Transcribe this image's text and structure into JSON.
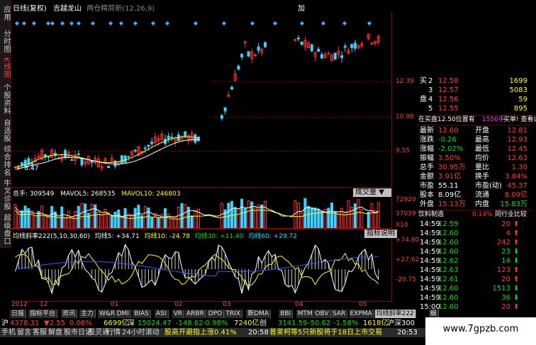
{
  "header": {
    "line1": "日线(复权)",
    "stock": "吉越龙山",
    "indicator": "两仓精简新(12,26,9)",
    "corner": "加"
  },
  "left_tabs": [
    "应用",
    "分时图",
    "K线图",
    "个股资料",
    "自选股",
    "综合排名",
    "牛叉诊股",
    "超级盘口"
  ],
  "kline": {
    "axis": [
      "12.39",
      "10.98",
      "9.55"
    ],
    "low_label": "8.47"
  },
  "volume": {
    "title": "总手: 309549",
    "mavol5": "MAVOL5: 268535",
    "mavol10": "MAVOL10: 246803",
    "button": "成交量",
    "axis": [
      "72920",
      "37039",
      "X10"
    ]
  },
  "indicator": {
    "title": "均线斜率222(5,10,30,60)",
    "l5": "均线5: +34.71",
    "l10": "均线10: -24.78",
    "l30": "均线30: +11.40",
    "l60": "均线60: +29.72",
    "button": "指标说明",
    "axis": [
      "+74.80",
      "+27.62",
      "-20.75"
    ]
  },
  "dates": [
    "2012",
    "12",
    "01",
    "02",
    "03",
    "04",
    "05"
  ],
  "orderbook": [
    {
      "side": "买",
      "n": "2",
      "price": "12.58",
      "vol": "1699"
    },
    {
      "side": "",
      "n": "3",
      "price": "12.57",
      "vol": "5083"
    },
    {
      "side": "盘",
      "n": "4",
      "price": "12.56",
      "vol": "59"
    },
    {
      "side": "",
      "n": "5",
      "price": "12.55",
      "vol": "895"
    }
  ],
  "info_line": {
    "left": "在买盘12.50位置有",
    "mid": "1550手",
    "right": "买单! 查看详细"
  },
  "quote": [
    {
      "l": "最新",
      "lv": "12.60",
      "r": "开盘",
      "rv": "12.81"
    },
    {
      "l": "涨跌",
      "lv": "-0.26",
      "r": "最高",
      "rv": "12.93"
    },
    {
      "l": "涨幅",
      "lv": "-2.02%",
      "r": "最低",
      "rv": "12.45"
    },
    {
      "l": "振幅",
      "lv": "3.50%",
      "r": "均价",
      "rv": "12.63"
    },
    {
      "l": "总手",
      "lv": "30.95万",
      "r": "量比",
      "rv": "1.30"
    },
    {
      "l": "金额",
      "lv": "3.91亿",
      "r": "换手",
      "rv": "3.84%"
    },
    {
      "l": "市盈",
      "lv": "55.11",
      "r": "市盈(动)",
      "rv": "45.37"
    },
    {
      "l": "股本",
      "lv": "8.09亿",
      "r": "流通",
      "rv": "8.09亿"
    },
    {
      "l": "外盘",
      "lv": "15.13万",
      "r": "内盘",
      "rv": "15.83万"
    }
  ],
  "sector": {
    "name": "饮料制造",
    "pct": "0.14%",
    "right": "同行业比较"
  },
  "ticks": [
    {
      "t": "14:59",
      "p": "12.59",
      "v": "20",
      "d": "up"
    },
    {
      "t": "14:59",
      "p": "12.60",
      "v": "4",
      "d": "up"
    },
    {
      "t": "14:59",
      "p": "12.60",
      "v": "242",
      "d": "up"
    },
    {
      "t": "14:59",
      "p": "12.60",
      "v": "23",
      "d": "down"
    },
    {
      "t": "14:59",
      "p": "12.62",
      "v": "14",
      "d": "down"
    },
    {
      "t": "14:59",
      "p": "12.63",
      "v": "123",
      "d": "up"
    },
    {
      "t": "14:59",
      "p": "12.61",
      "v": "20",
      "d": "up"
    },
    {
      "t": "14:59",
      "p": "12.60",
      "v": "1513",
      "d": "down"
    },
    {
      "t": "14:59",
      "p": "12.60",
      "v": "36",
      "d": "down"
    },
    {
      "t": "15:00",
      "p": "12.60",
      "v": "20",
      "d": "up"
    }
  ],
  "bottom_tabs": [
    "日报",
    "指标平台",
    "资讯",
    "主力",
    "W&R",
    "DMI",
    "BIAS",
    "ASI",
    "VR",
    "ARBR",
    "DPO",
    "TRIX",
    "新DMA",
    "BBI",
    "MTM",
    "OBV",
    "SAR",
    "EXPMA",
    "均线斜率222",
    "细"
  ],
  "status": {
    "sh_label": "沪",
    "sh_val": "4378.31",
    "sh_chg": "▼2.55",
    "sh_pct": "0.06%",
    "sh_amt": "6699亿",
    "sz_label": "深",
    "sz_val": "15024.47",
    "sz_chg": "-148.62",
    "sz_pct": "-0.98%",
    "sz_amt": "7240亿",
    "cy_label": "创",
    "cy_val": "3141.59",
    "cy_chg": "-50.62",
    "cy_pct": "-1.58%",
    "hs_amt": "1618亿",
    "hs_label": "沪深300"
  },
  "taskbar": {
    "items": [
      "手机",
      "留言",
      "客服",
      "解盘",
      "股市日记",
      "股灵通",
      "行情",
      "24小时滚动"
    ],
    "news_left": "股高开避指上涨0.41%",
    "news_time": "20:58",
    "news": "普莱柯等5只新股将于18日上市交易",
    "time": "20:53",
    "right": "代码/"
  },
  "watermark": "www.7gpzb.com",
  "chart_data": {
    "type": "candlestick",
    "x_labels": [
      "2012",
      "12",
      "01",
      "02",
      "03",
      "04",
      "05"
    ],
    "price_axis_ticks": [
      12.39,
      10.98,
      9.55
    ],
    "min_label": 8.47,
    "volume_axis_ticks": [
      72920,
      37039
    ],
    "indicator_axis_ticks": [
      74.8,
      27.62,
      -20.75
    ]
  }
}
